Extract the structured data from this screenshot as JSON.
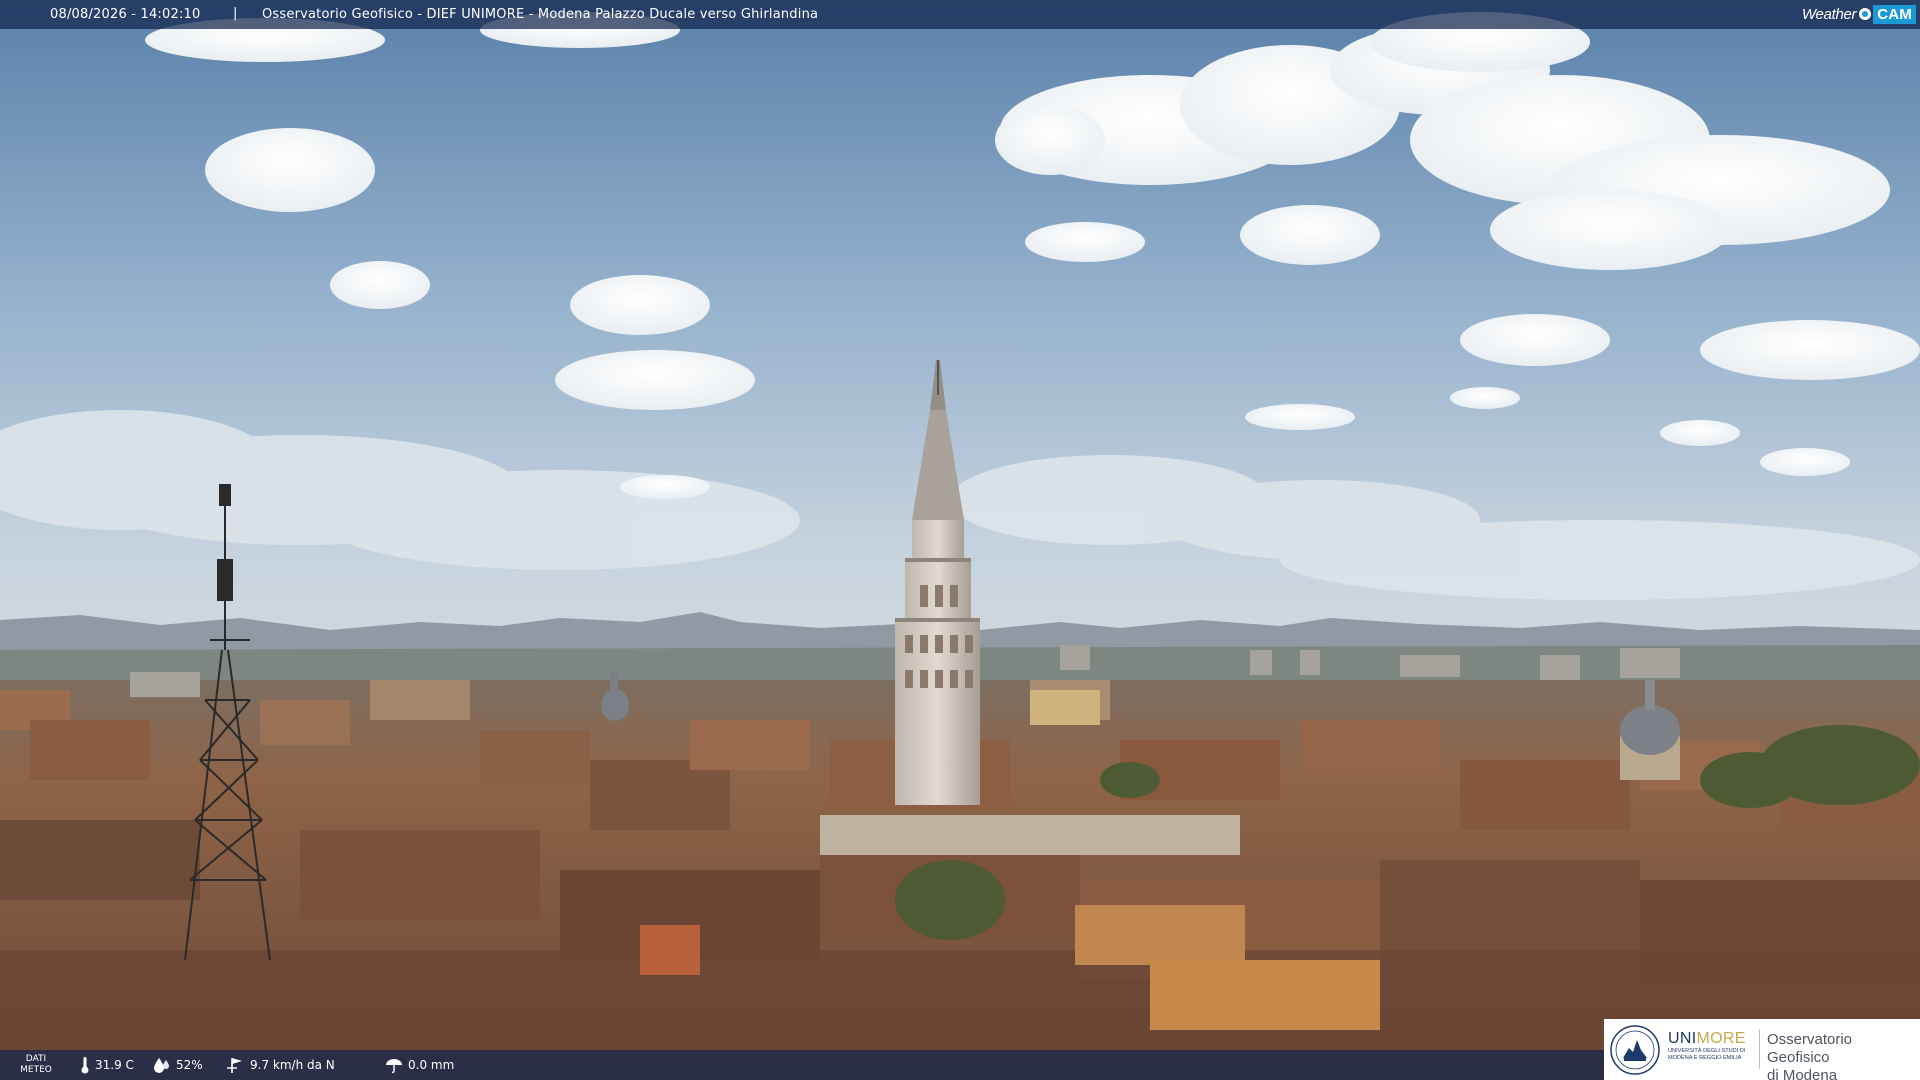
{
  "overlay": {
    "timestamp": "08/08/2026 - 14:02:10",
    "separator": "|",
    "camera_title": "Osservatorio Geofisico - DIEF UNIMORE - Modena Palazzo Ducale verso Ghirlandina"
  },
  "brand": {
    "weather_text": "Weather",
    "cam_text": "CAM",
    "accent_color": "#1c9ad6"
  },
  "weather": {
    "label_line1": "DATI",
    "label_line2": "METEO",
    "temperature": "31.9 C",
    "temperature_icon": "thermometer-icon",
    "humidity": "52%",
    "humidity_icon": "droplet-icon",
    "wind": "9.7 km/h da N",
    "wind_icon": "wind-icon",
    "rain": "0.0 mm",
    "rain_icon": "rain-icon"
  },
  "logo": {
    "uni_prefix": "UNI",
    "uni_suffix": "MORE",
    "uni_subtitle": "Università degli studi di Modena e Reggio Emilia",
    "observatory_line1": "Osservatorio Geofisico",
    "observatory_line2": "di Modena",
    "brand_blue": "#1b3a6b",
    "brand_gold": "#c8a64a"
  },
  "colors": {
    "sky_top": "#5e84ad",
    "sky_horizon": "#c6d3df",
    "roofs": "#8a5a3f",
    "overlay_bar": "#12264e"
  }
}
